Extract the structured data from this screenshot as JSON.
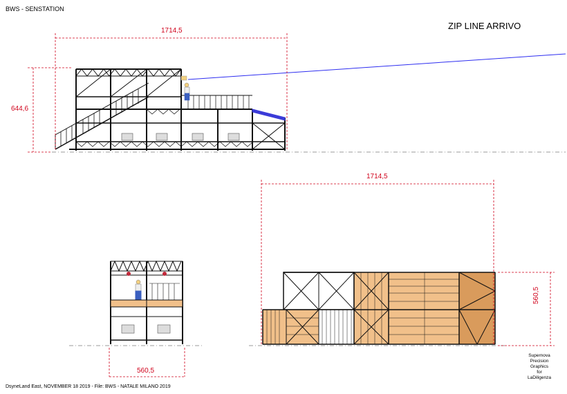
{
  "header": {
    "project": "BWS - SENSTATION",
    "view_title": "ZIP LINE ARRIVO"
  },
  "dimensions": {
    "top_width": "1714,5",
    "top_height": "644,6",
    "plan_width": "1714,5",
    "plan_depth": "560,5",
    "side_width": "560,5"
  },
  "footer": {
    "info": "DsyneLand East, NOVEMBER 18 2019  -  File: BWS - NATALE MILANO 2019",
    "credit": [
      "Supernova",
      "Precision",
      "Graphics",
      "for",
      "LaDiligenza"
    ]
  },
  "colors": {
    "dimension": "#d0021b",
    "wood": "#f1c08a",
    "wood_dark": "#d99b5c",
    "cable": "#2d2df0",
    "ramp": "#3b3bd8",
    "steel": "#111111"
  }
}
